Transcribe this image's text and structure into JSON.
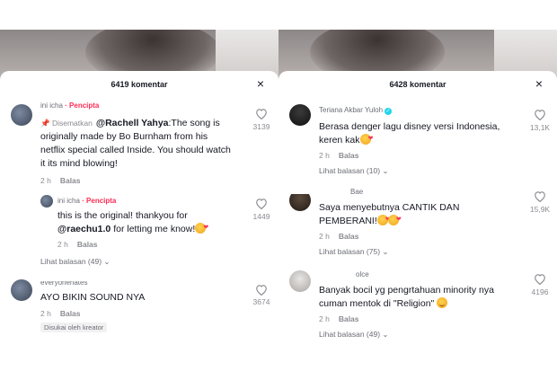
{
  "left": {
    "header": {
      "title": "6419 komentar",
      "close": "×"
    },
    "comments": [
      {
        "username": "ini icha",
        "creator_tag": "· Pencipta",
        "pinned_label": "📌 Disematkan",
        "mention": "@Rachell Yahya",
        "text": ":The song is originally made by Bo Burnham from his netflix special called Inside. You should watch it its mind blowing!",
        "time": "2 h",
        "reply_label": "Balas",
        "likes": "3139"
      },
      {
        "username": "ini icha",
        "creator_tag": "· Pencipta",
        "text_before": "this is the original! thankyou for",
        "mention": "@raechu1.0",
        "text_after": "for letting me know!",
        "time": "2 h",
        "reply_label": "Balas",
        "likes": "1449"
      },
      {
        "view_replies": "Lihat balasan (49)",
        "username": "everyonehates",
        "text": "AYO BIKIN SOUND NYA",
        "time": "2 h",
        "reply_label": "Balas",
        "likes": "3674",
        "liked_badge": "Disukai oleh kreator"
      }
    ]
  },
  "right": {
    "header": {
      "title": "6428 komentar",
      "close": "×"
    },
    "comments": [
      {
        "username": "Teriana Akbar Yuloh",
        "text": "Berasa denger lagu disney versi Indonesia, keren kak",
        "time": "2 h",
        "reply_label": "Balas",
        "likes": "13,1K",
        "view_replies": "Lihat balasan (10)"
      },
      {
        "username": "Bae",
        "text": "Saya menyebutnya CANTIK DAN PEMBERANI!",
        "time": "2 h",
        "reply_label": "Balas",
        "likes": "15,9K",
        "view_replies": "Lihat balasan (75)"
      },
      {
        "username": "olce",
        "text": "Banyak bocil yg pengrtahuan minority nya cuman mentok di \"Religion\"",
        "time": "2 h",
        "reply_label": "Balas",
        "likes": "4196",
        "view_replies": "Lihat balasan (49)"
      }
    ]
  },
  "icons": {
    "heart": "heart-outline-icon",
    "close": "close-icon",
    "chevron": "chevron-down-icon",
    "pin": "pin-icon",
    "verified": "verified-badge-icon"
  },
  "colors": {
    "creator_accent": "#fe2c55",
    "verified": "#20d5ec",
    "text": "#161823",
    "muted": "#8a8b91"
  }
}
